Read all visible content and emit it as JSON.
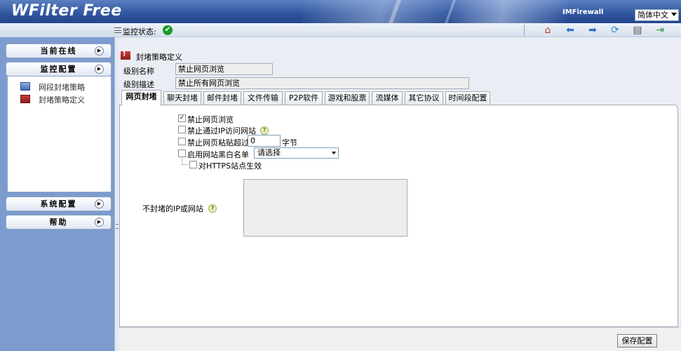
{
  "header": {
    "app_title": "WFilter Free",
    "brand": "IMFirewall",
    "language": "简体中文"
  },
  "toolbar": {
    "monitor_status_label": "监控状态:",
    "status_icon": "check-circle-icon",
    "icons": [
      "home-icon",
      "back-arrow-icon",
      "forward-arrow-icon",
      "refresh-icon",
      "print-icon",
      "exit-icon"
    ]
  },
  "sidebar": {
    "sections": [
      {
        "label": "当前在线"
      },
      {
        "label": "监控配置"
      },
      {
        "label": "系统配置"
      },
      {
        "label": "帮助"
      }
    ],
    "items": [
      {
        "label": "网段封堵策略",
        "icon": "monitor-icon"
      },
      {
        "label": "封堵策略定义",
        "icon": "block-policy-icon"
      }
    ]
  },
  "main": {
    "page_title": "封堵策略定义",
    "level_name_label": "级别名称",
    "level_name_value": "禁止网页浏览",
    "level_desc_label": "级别描述",
    "level_desc_value": "禁止所有网页浏览",
    "tabs": [
      {
        "label": "网页封堵",
        "active": true
      },
      {
        "label": "聊天封堵",
        "active": false
      },
      {
        "label": "邮件封堵",
        "active": false
      },
      {
        "label": "文件传输",
        "active": false
      },
      {
        "label": "P2P软件",
        "active": false
      },
      {
        "label": "游戏和股票",
        "active": false
      },
      {
        "label": "流媒体",
        "active": false
      },
      {
        "label": "其它协议",
        "active": false
      },
      {
        "label": "时间段配置",
        "active": false
      }
    ],
    "options": {
      "block_web_label": "禁止网页浏览",
      "block_web_checked": true,
      "block_ip_label": "禁止通过IP访问网站",
      "block_ip_checked": false,
      "block_paste_label": "禁止网页粘贴超过",
      "block_paste_checked": false,
      "paste_value": "0",
      "paste_unit": "字节",
      "whitelist_label": "启用网站黑白名单",
      "whitelist_checked": false,
      "whitelist_select_value": "请选择",
      "https_label": "对HTTPS站点生效",
      "https_checked": false
    },
    "exclude_label": "不封堵的IP或网站",
    "exclude_value": "",
    "save_button": "保存配置"
  }
}
